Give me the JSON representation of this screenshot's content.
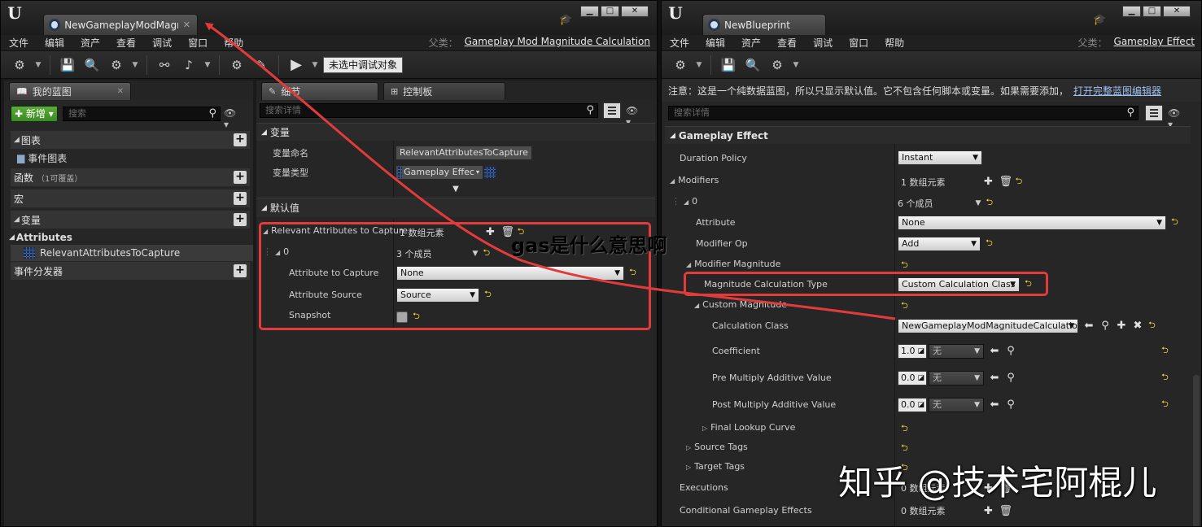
{
  "left": {
    "doc_tab": "NewGameplayModMagnit",
    "win_buttons": [
      "▁",
      "□",
      "✕"
    ],
    "menu": [
      "文件",
      "编辑",
      "资产",
      "查看",
      "调试",
      "窗口",
      "帮助"
    ],
    "parent_label": "父类：",
    "parent_value": "Gameplay Mod Magnitude Calculation",
    "debug_select": "未选中调试对象",
    "my_bp": {
      "tab": "我的蓝图",
      "new_btn": "新增",
      "search_placeholder": "搜索",
      "graph": "图表",
      "event_graph": "事件图表",
      "functions": "函数",
      "functions_sub": "（1可覆盖）",
      "macros": "宏",
      "variables": "变量",
      "attributes_cat": "Attributes",
      "var_item": "RelevantAttributesToCapture",
      "dispatchers": "事件分发器"
    },
    "details": {
      "tab": "细节",
      "tab2": "控制板",
      "search_placeholder": "搜索详情",
      "var_cat": "变量",
      "var_name_label": "变量命名",
      "var_name_value": "RelevantAttributesToCapture",
      "var_type_label": "变量类型",
      "var_type_value": "Gameplay Effec",
      "defaults_cat": "默认值",
      "rac_label": "Relevant Attributes to Capture",
      "rac_value": "1 数组元素",
      "idx0_label": "0",
      "idx0_value": "3 个成员",
      "atc_label": "Attribute to Capture",
      "atc_value": "None",
      "as_label": "Attribute Source",
      "as_value": "Source",
      "snap_label": "Snapshot"
    }
  },
  "right": {
    "doc_tab": "NewBlueprint",
    "win_buttons": [
      "▁",
      "□",
      "✕"
    ],
    "menu": [
      "文件",
      "编辑",
      "资产",
      "查看",
      "调试",
      "窗口",
      "帮助"
    ],
    "parent_label": "父类：",
    "parent_value": "Gameplay Effect",
    "notice": "注意：这是一个纯数据蓝图，所以只显示默认值。它不包含任何脚本或变量。如果需要添加，",
    "notice_link": "打开完整蓝图编辑器",
    "search_placeholder": "搜索详情",
    "cat_ge": "Gameplay Effect",
    "duration_label": "Duration Policy",
    "duration_value": "Instant",
    "modifiers_label": "Modifiers",
    "modifiers_value": "1 数组元素",
    "m0_label": "0",
    "m0_value": "6 个成员",
    "attribute_label": "Attribute",
    "attribute_value": "None",
    "modop_label": "Modifier Op",
    "modop_value": "Add",
    "modmag_label": "Modifier Magnitude",
    "mct_label": "Magnitude Calculation Type",
    "mct_value": "Custom Calculation Class",
    "custmag_label": "Custom Magnitude",
    "calcclass_label": "Calculation Class",
    "calcclass_value": "NewGameplayModMagnitudeCalculation",
    "coef_label": "Coefficient",
    "coef_value": "1.0",
    "none_cn": "无",
    "pre_label": "Pre Multiply Additive Value",
    "pre_value": "0.0",
    "post_label": "Post Multiply Additive Value",
    "post_value": "0.0",
    "flc_label": "Final Lookup Curve",
    "src_label": "Source Tags",
    "tgt_label": "Target Tags",
    "exec_label": "Executions",
    "exec_value": "0 数组元素",
    "cge_label": "Conditional Gameplay Effects",
    "cge_value": "0 数组元素"
  },
  "overlay_question": "gas是什么意思啊",
  "watermark": "知乎 @技术宅阿棍儿",
  "colors": {
    "annotation_red": "#e23b3b",
    "reset_yellow": "#e8d53a",
    "new_green": "#4a9a2e"
  }
}
